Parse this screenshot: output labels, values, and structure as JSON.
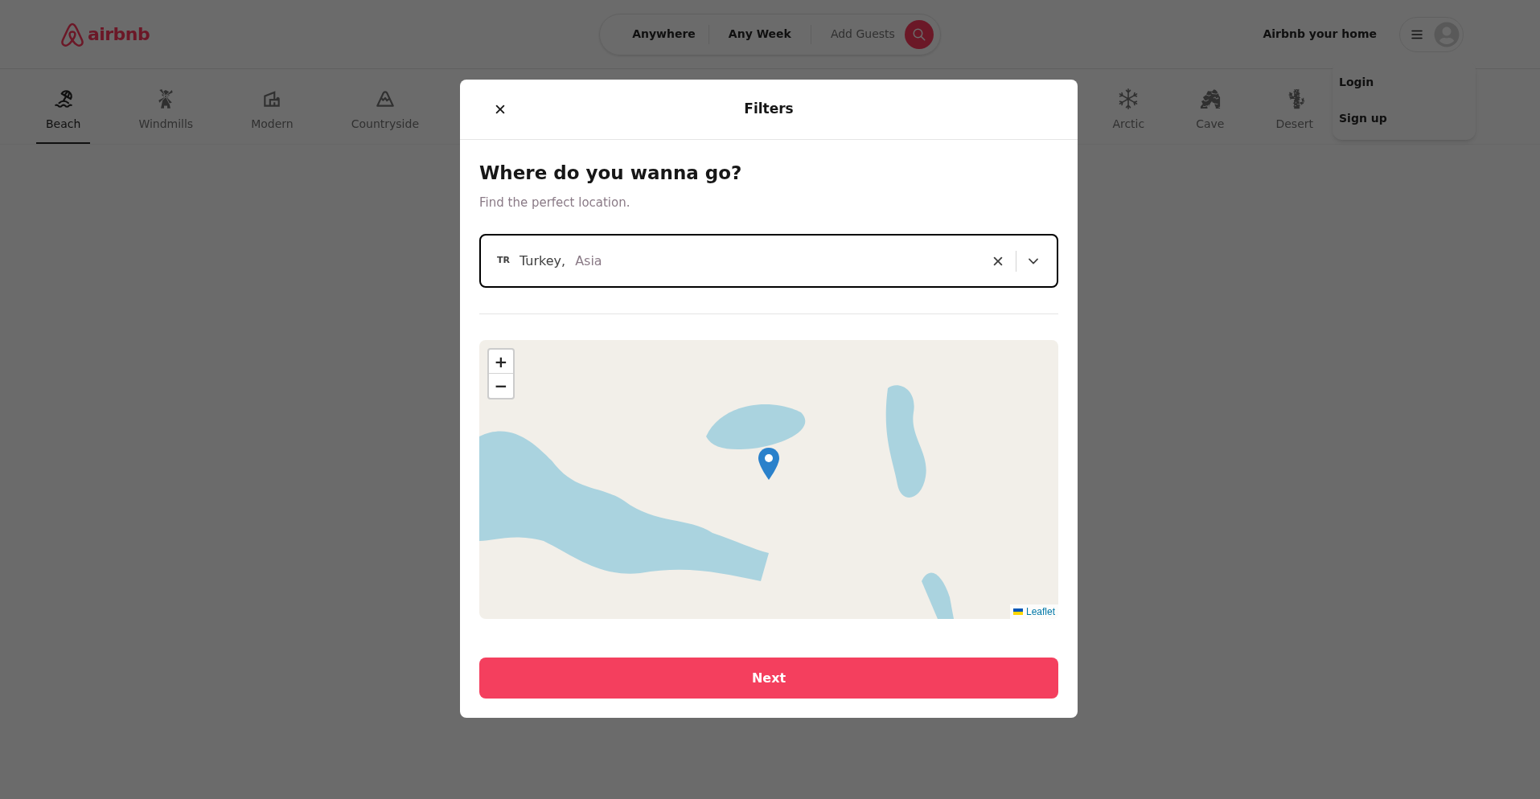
{
  "navbar": {
    "logo_text": "airbnb",
    "search": {
      "location": "Anywhere",
      "week": "Any Week",
      "guests": "Add Guests"
    },
    "host_link": "Airbnb your home",
    "user_menu": {
      "items": [
        "Login",
        "Sign up"
      ]
    }
  },
  "categories": [
    {
      "label": "Beach",
      "selected": true
    },
    {
      "label": "Windmills",
      "selected": false
    },
    {
      "label": "Modern",
      "selected": false
    },
    {
      "label": "Countryside",
      "selected": false
    },
    {
      "label": "Arctic",
      "selected": false
    },
    {
      "label": "Cave",
      "selected": false
    },
    {
      "label": "Desert",
      "selected": false
    }
  ],
  "modal": {
    "title": "Filters",
    "heading": "Where do you wanna go?",
    "subtitle": "Find the perfect location.",
    "location_select": {
      "country_code": "TR",
      "country": "Turkey,",
      "region": "Asia"
    },
    "map": {
      "zoom_in": "+",
      "zoom_out": "−",
      "attribution": "Leaflet"
    },
    "next_button": "Next"
  }
}
